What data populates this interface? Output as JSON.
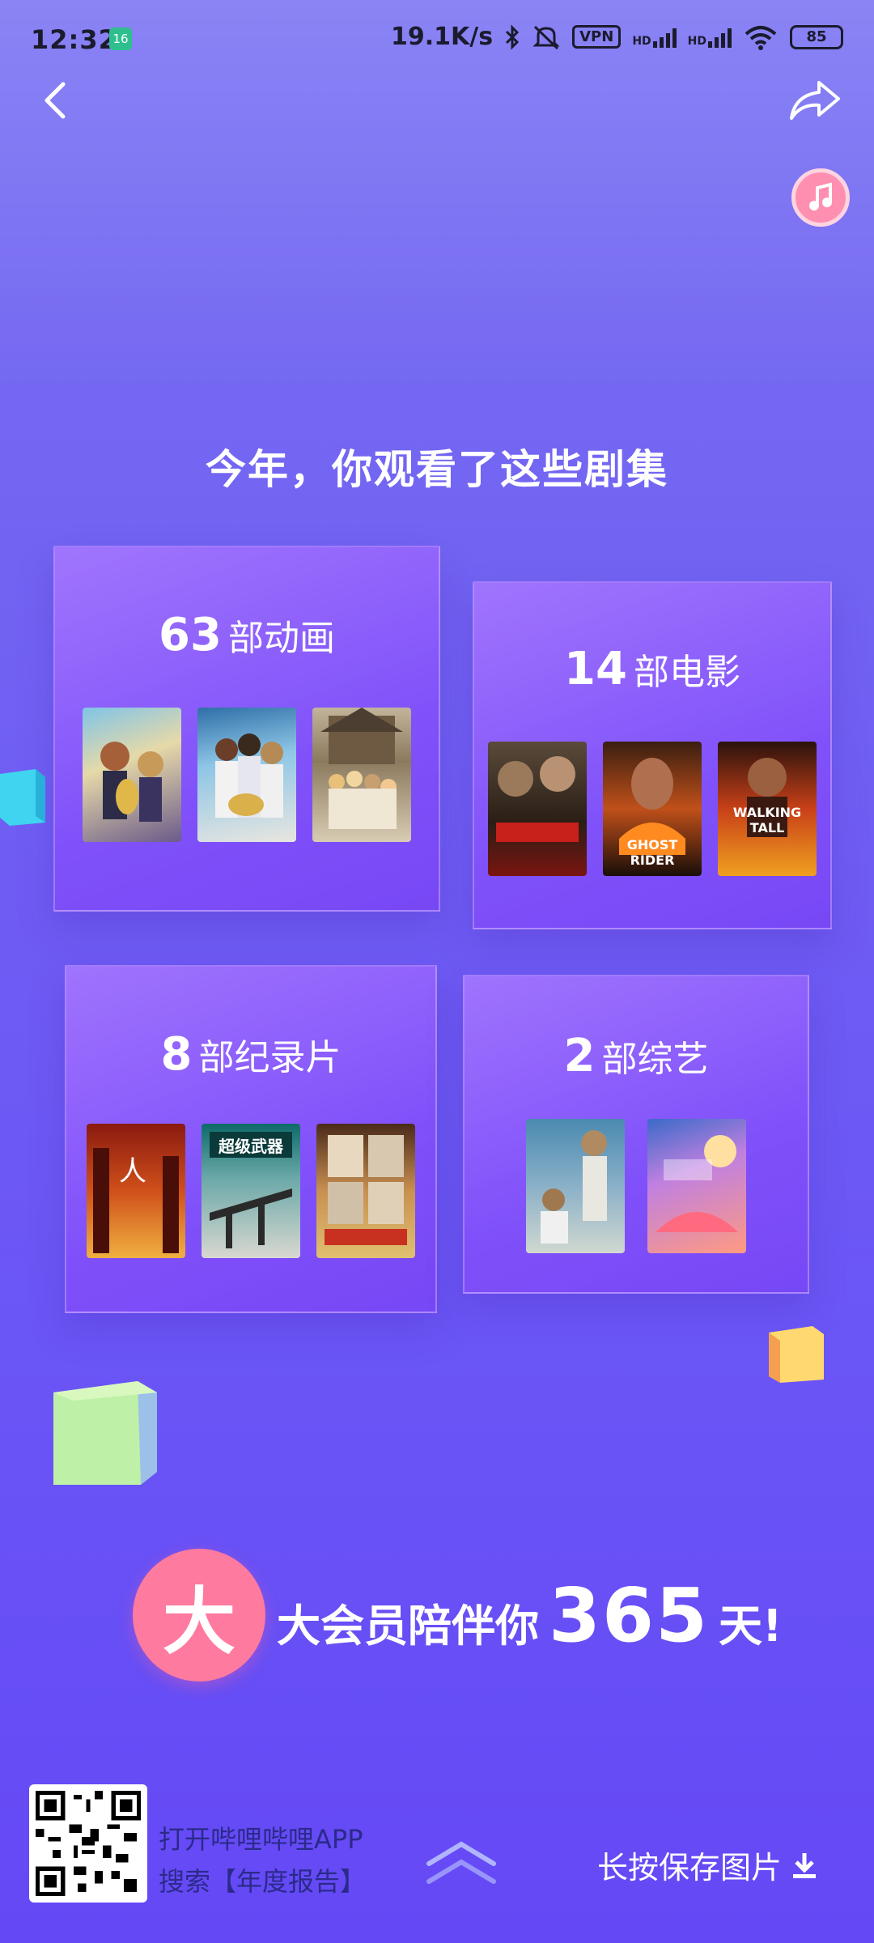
{
  "status_bar": {
    "time": "12:32",
    "notification_badge": "16",
    "net_speed": "19.1K/s",
    "vpn": "VPN",
    "hd1": "HD",
    "hd2": "HD",
    "wifi_level": "6",
    "battery": "85"
  },
  "nav": {
    "back_icon": "chevron-left-icon",
    "share_icon": "share-arrow-icon",
    "music_icon": "music-note-icon"
  },
  "headline": "今年，你观看了这些剧集",
  "categories": [
    {
      "count": "63",
      "label": "部动画",
      "posters": [
        "poster-anime-1",
        "poster-anime-2",
        "poster-anime-3"
      ]
    },
    {
      "count": "14",
      "label": "部电影",
      "posters": [
        "poster-movie-1",
        "poster-movie-2",
        "poster-movie-3"
      ],
      "poster_texts": [
        "",
        "GHOST RIDER",
        "WALKING TALL"
      ]
    },
    {
      "count": "8",
      "label": "部纪录片",
      "posters": [
        "poster-doc-1",
        "poster-doc-2",
        "poster-doc-3"
      ],
      "poster_texts": [
        "",
        "超级武器",
        ""
      ]
    },
    {
      "count": "2",
      "label": "部综艺",
      "posters": [
        "poster-variety-1",
        "poster-variety-2"
      ]
    }
  ],
  "vip": {
    "badge": "大",
    "text_prefix": "大会员陪伴你",
    "days": "365",
    "text_suffix": "天!"
  },
  "footer": {
    "line1": "打开哔哩哔哩APP",
    "line2": "搜索【年度报告】",
    "save_hint": "长按保存图片",
    "download_icon": "download-icon",
    "chevron_icon": "double-chevron-up-icon"
  },
  "colors": {
    "accent_pink": "#ff7a9f",
    "card_purple": "#8a55fa"
  }
}
